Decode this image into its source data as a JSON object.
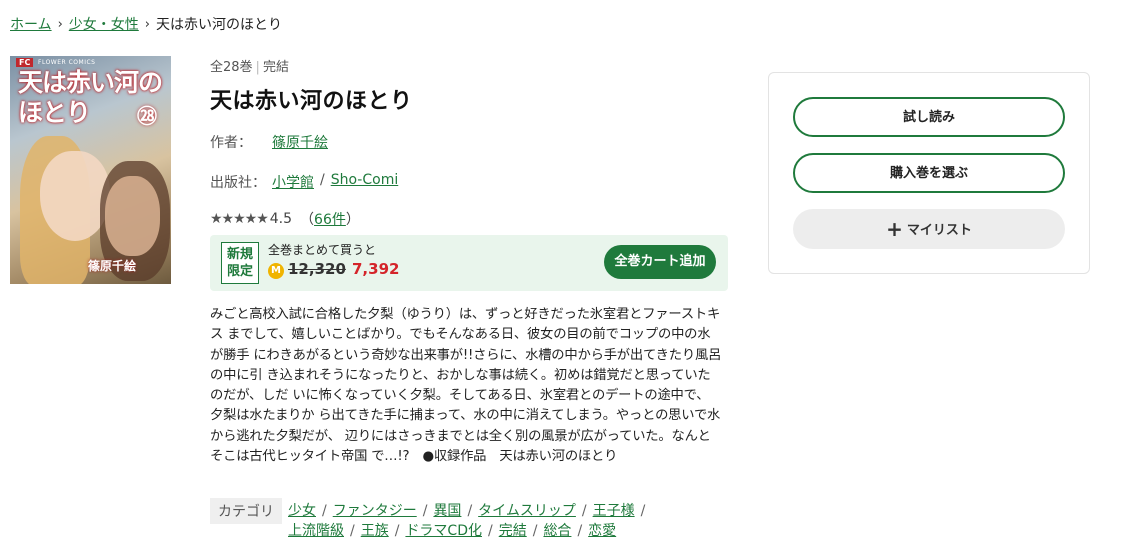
{
  "breadcrumb": {
    "home": "ホーム",
    "category": "少女・女性",
    "current": "天は赤い河のほとり"
  },
  "cover": {
    "label_fc": "FC",
    "label_imprint": "FLOWER COMICS",
    "title_line1": "天は赤い河の",
    "title_line2": "ほとり",
    "volume": "㉘",
    "author": "篠原千絵"
  },
  "book": {
    "volumes": "全28巻",
    "status": "完結",
    "title": "天は赤い河のほとり",
    "author_label": "作者：",
    "author": "篠原千絵",
    "publisher_label": "出版社：",
    "publisher": "小学館",
    "label": "Sho-Comi",
    "rating_stars": "★★★★★",
    "rating": "4.5",
    "review_count_open": "（",
    "review_count": "66件",
    "review_count_close": "）"
  },
  "promo": {
    "badge_line1": "新規",
    "badge_line2": "限定",
    "text": "全巻まとめて買うと",
    "coin": "M",
    "original_price": "12,320",
    "price": "7,392",
    "cart_button": "全巻カート追加"
  },
  "description": "みごと高校入試に合格した夕梨（ゆうり）は、ずっと好きだった氷室君とファーストキス までして、嬉しいことばかり。でもそんなある日、彼女の目の前でコップの中の水が勝手 にわきあがるという奇妙な出来事が!!さらに、水槽の中から手が出てきたり風呂の中に引 き込まれそうになったりと、おかしな事は続く。初めは錯覚だと思っていたのだが、しだ いに怖くなっていく夕梨。そしてある日、氷室君とのデートの途中で、夕梨は水たまりか ら出てきた手に捕まって、水の中に消えてしまう。やっとの思いで水から逃れた夕梨だが、 辺りにはさっきまでとは全く別の風景が広がっていた。なんとそこは古代ヒッタイト帝国 で…!?　●収録作品　天は赤い河のほとり",
  "categories": {
    "label": "カテゴリ",
    "items": [
      "少女",
      "ファンタジー",
      "異国",
      "タイムスリップ",
      "王子様",
      "上流階級",
      "王族",
      "ドラマCD化",
      "完結",
      "総合",
      "恋愛"
    ]
  },
  "side": {
    "trial": "試し読み",
    "select_volume": "購入巻を選ぶ",
    "mylist": "マイリスト",
    "plus": "+"
  },
  "colors": {
    "accent": "#1f7a3c",
    "price": "#d4242a",
    "promo_bg": "#e9f5ec"
  }
}
